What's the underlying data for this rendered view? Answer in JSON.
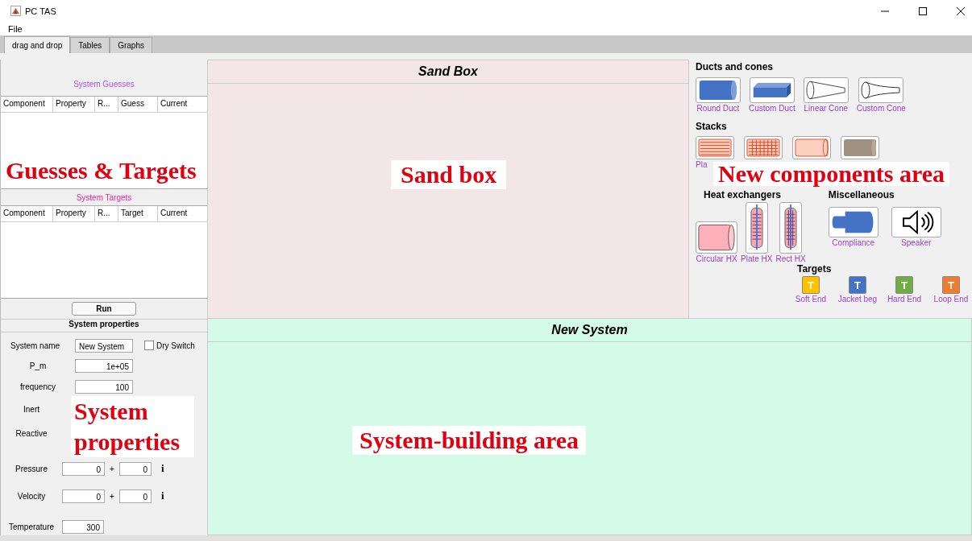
{
  "window": {
    "title": "PC TAS"
  },
  "menu": [
    "File"
  ],
  "tabs": [
    {
      "label": "drag and drop",
      "selected": true
    },
    {
      "label": "Tables",
      "selected": false
    },
    {
      "label": "Graphs",
      "selected": false
    }
  ],
  "guesses": {
    "title": "System Guesses",
    "columns": [
      "Component",
      "Property",
      "R...",
      "Guess",
      "Current"
    ]
  },
  "targets": {
    "title": "System Targets",
    "columns": [
      "Component",
      "Property",
      "R...",
      "Target",
      "Current"
    ]
  },
  "run_button": "Run",
  "system_properties": {
    "title": "System properties",
    "fields": [
      {
        "kind": "name",
        "label": "System name",
        "value": "New System",
        "checkbox": {
          "label": "Dry Switch",
          "checked": false
        }
      },
      {
        "kind": "single",
        "label": "P_m",
        "value": "1e+05"
      },
      {
        "kind": "single",
        "label": "frequency",
        "value": "100"
      },
      {
        "kind": "label",
        "label": "Inert"
      },
      {
        "kind": "label",
        "label": "Reactive"
      },
      {
        "kind": "complex",
        "label": "Pressure",
        "real": "0",
        "plus": "+",
        "imag": "0",
        "unit": "i"
      },
      {
        "kind": "complex",
        "label": "Velocity",
        "real": "0",
        "plus": "+",
        "imag": "0",
        "unit": "i"
      },
      {
        "kind": "short",
        "label": "Temperature",
        "value": "300"
      }
    ]
  },
  "sandbox": {
    "title": "Sand Box"
  },
  "system": {
    "title": "New System"
  },
  "palette": {
    "ducts": {
      "title": "Ducts and cones",
      "items": [
        {
          "kind": "round-duct",
          "label": "Round Duct"
        },
        {
          "kind": "custom-duct",
          "label": "Custom Duct"
        },
        {
          "kind": "linear-cone",
          "label": "Linear Cone"
        },
        {
          "kind": "custom-cone",
          "label": "Custom Cone"
        }
      ]
    },
    "stacks": {
      "title": "Stacks",
      "items": [
        {
          "kind": "stack-plate",
          "label": "Pla"
        },
        {
          "kind": "stack-grid"
        },
        {
          "kind": "stack-pin"
        },
        {
          "kind": "stack-random"
        }
      ]
    },
    "heat_exchangers": {
      "title": "Heat exchangers",
      "items": [
        {
          "kind": "hx-circular",
          "label": "Circular HX"
        },
        {
          "kind": "hx-plate",
          "label": "Plate HX"
        },
        {
          "kind": "hx-rect",
          "label": "Rect HX"
        }
      ]
    },
    "miscellaneous": {
      "title": "Miscellaneous",
      "items": [
        {
          "kind": "compliance",
          "label": "Compliance"
        },
        {
          "kind": "speaker",
          "label": "Speaker"
        }
      ]
    },
    "targets": {
      "title": "Targets",
      "items": [
        {
          "glyph": "T",
          "color": "#ffc000",
          "label": "Soft End"
        },
        {
          "glyph": "T",
          "color": "#4472c4",
          "label": "Jacket beg"
        },
        {
          "glyph": "T",
          "color": "#70ad47",
          "label": "Hard End"
        },
        {
          "glyph": "T",
          "color": "#ed7d31",
          "label": "Loop End"
        }
      ]
    }
  },
  "annotations": [
    {
      "kind": "guesses",
      "text": "Guesses & Targets"
    },
    {
      "kind": "sandbox",
      "text": "Sand box"
    },
    {
      "kind": "components",
      "text": "New components area"
    },
    {
      "kind": "properties",
      "text": "System properties"
    },
    {
      "kind": "system",
      "text": "System-building area"
    }
  ]
}
